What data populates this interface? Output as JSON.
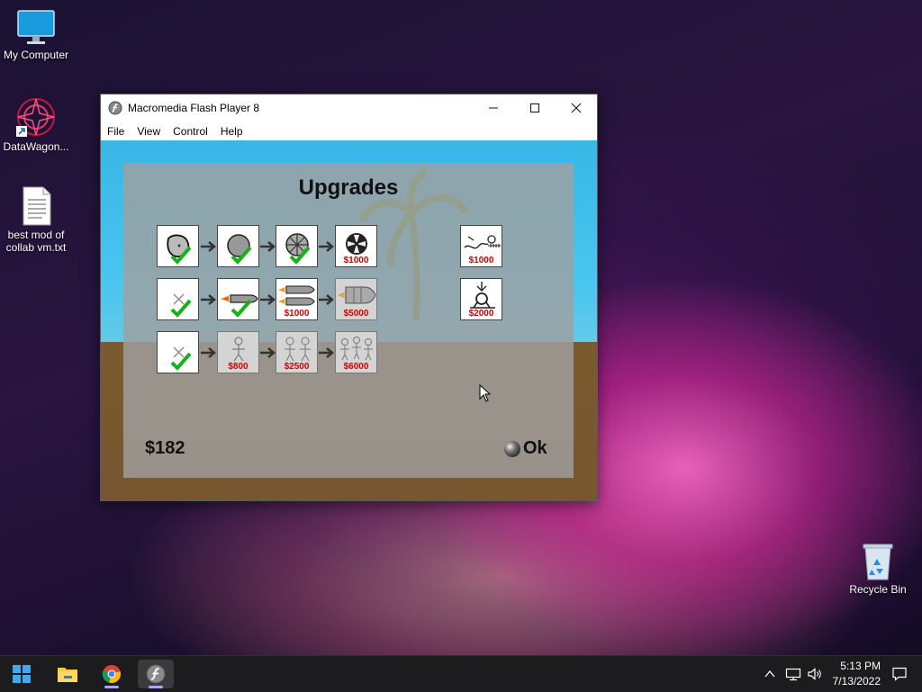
{
  "desktop": {
    "icons": [
      {
        "label": "My Computer",
        "icon": "monitor-icon"
      },
      {
        "label": "DataWagon...",
        "icon": "datawagon-icon"
      },
      {
        "label": "best mod of collab vm.txt",
        "icon": "text-file-icon"
      },
      {
        "label": "Recycle Bin",
        "icon": "recycle-bin-icon"
      }
    ]
  },
  "window": {
    "title": "Macromedia Flash Player 8",
    "menu": [
      "File",
      "View",
      "Control",
      "Help"
    ]
  },
  "game": {
    "title": "Upgrades",
    "money": "$182",
    "ok_label": "Ok",
    "rows": [
      [
        {
          "icon": "rock-icon",
          "price": "",
          "owned": true
        },
        {
          "icon": "ball-icon",
          "price": "",
          "owned": true
        },
        {
          "icon": "wheel-icon",
          "price": "",
          "owned": true
        },
        {
          "icon": "fan-wheel-icon",
          "price": "$1000",
          "owned": false
        }
      ],
      [
        {
          "icon": "none-icon",
          "price": "",
          "owned": true
        },
        {
          "icon": "rocket-icon",
          "price": "",
          "owned": true
        },
        {
          "icon": "double-rocket-icon",
          "price": "$1000",
          "owned": false
        },
        {
          "icon": "big-rocket-icon",
          "price": "$5000",
          "owned": false
        }
      ],
      [
        {
          "icon": "none-icon",
          "price": "",
          "owned": true
        },
        {
          "icon": "one-person-icon",
          "price": "$800",
          "owned": false
        },
        {
          "icon": "two-people-icon",
          "price": "$2500",
          "owned": false
        },
        {
          "icon": "three-people-icon",
          "price": "$6000",
          "owned": false
        }
      ]
    ],
    "extras": [
      {
        "icon": "spring-launcher-icon",
        "price": "$1000"
      },
      {
        "icon": "catapult-icon",
        "price": "$2000"
      }
    ]
  },
  "taskbar": {
    "apps": [
      "start-icon",
      "file-explorer-icon",
      "chrome-icon",
      "flash-player-icon"
    ],
    "time": "5:13 PM",
    "date": "7/13/2022"
  }
}
